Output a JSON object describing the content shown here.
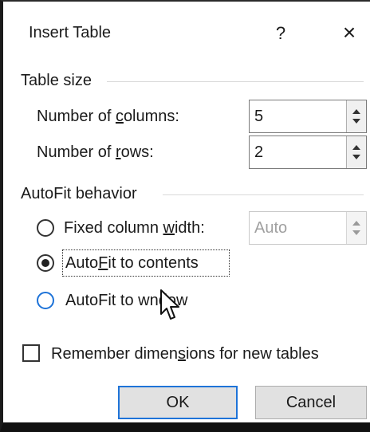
{
  "dialog": {
    "title": "Insert Table",
    "help_label": "?",
    "close_label": "×"
  },
  "table_size": {
    "heading": "Table size",
    "columns": {
      "label_pre": "Number of ",
      "label_key": "c",
      "label_post": "olumns:",
      "value": "5"
    },
    "rows": {
      "label_pre": "Number of ",
      "label_key": "r",
      "label_post": "ows:",
      "value": "2"
    }
  },
  "autofit": {
    "heading": "AutoFit behavior",
    "fixed": {
      "label_pre": "Fixed column ",
      "label_key": "w",
      "label_post": "idth:",
      "value": "Auto",
      "selected": false
    },
    "contents": {
      "label_pre": "Auto",
      "label_key": "F",
      "label_post": "it to contents",
      "selected": true
    },
    "window": {
      "label_pre": "AutoFit to w",
      "label_key": "",
      "label_post": "ndow",
      "selected": false
    }
  },
  "remember": {
    "label_pre": "Remember dimen",
    "label_key": "s",
    "label_post": "ions for new tables",
    "checked": false
  },
  "buttons": {
    "ok_label": "OK",
    "cancel_label": "Cancel"
  },
  "colors": {
    "accent": "#1e73d8"
  }
}
